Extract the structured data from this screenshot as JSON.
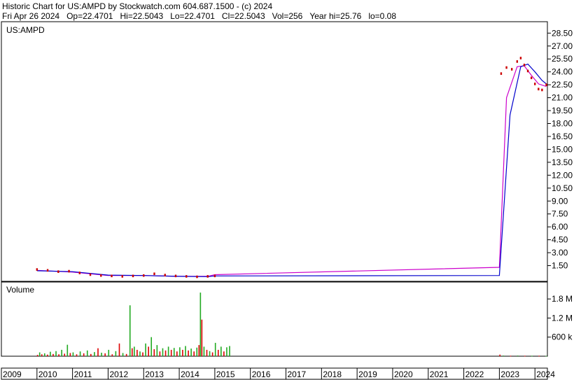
{
  "header": {
    "title": "Historic Chart for US:AMPD by Stockwatch.com 604.687.1500 - (c) 2024",
    "date": "Fri Apr 26 2024",
    "open": "Op=22.4701",
    "high": "Hi=22.5043",
    "low": "Lo=22.4701",
    "close": "Cl=22.5043",
    "volume": "Vol=256",
    "year_high": "Year hi=25.76",
    "year_low": "lo=0.08"
  },
  "colors": {
    "price_dots": "#cc0000",
    "ma_short": "#cc00cc",
    "ma_long": "#0000cc",
    "vol_up": "#22aa22",
    "vol_down": "#dd0000"
  },
  "chart_data": [
    {
      "type": "line",
      "title": "US:AMPD",
      "y_ticks": [
        "28.50",
        "27.00",
        "25.50",
        "24.00",
        "22.50",
        "21.00",
        "19.50",
        "18.00",
        "16.50",
        "15.00",
        "13.50",
        "12.00",
        "10.50",
        "9.00",
        "7.50",
        "6.00",
        "4.50",
        "3.00",
        "1.50"
      ],
      "ylim": [
        0,
        29.5
      ],
      "x_ticks": [
        "2009",
        "2010",
        "2011",
        "2012",
        "2013",
        "2014",
        "2015",
        "2016",
        "2017",
        "2018",
        "2019",
        "2020",
        "2021",
        "2022",
        "2023",
        "2024"
      ],
      "series": [
        {
          "role": "price",
          "x": [
            2010.0,
            2010.3,
            2010.6,
            2010.9,
            2011.2,
            2011.5,
            2011.8,
            2012.1,
            2012.4,
            2012.7,
            2013.0,
            2013.3,
            2013.6,
            2013.9,
            2014.2,
            2014.5,
            2014.8,
            2015.0,
            2023.05,
            2023.2,
            2023.35,
            2023.5,
            2023.6,
            2023.7,
            2023.8,
            2023.9,
            2024.0,
            2024.1,
            2024.2,
            2024.32
          ],
          "y": [
            1.05,
            0.95,
            0.8,
            0.85,
            0.65,
            0.45,
            0.35,
            0.3,
            0.25,
            0.3,
            0.35,
            0.55,
            0.4,
            0.3,
            0.25,
            0.2,
            0.25,
            0.3,
            23.8,
            24.5,
            24.3,
            25.2,
            25.6,
            24.8,
            24.1,
            23.3,
            22.6,
            22.0,
            21.9,
            22.5
          ]
        },
        {
          "role": "ma_short",
          "x": [
            2010.0,
            2011.0,
            2012.0,
            2013.0,
            2014.0,
            2014.8,
            2015.0,
            2023.0,
            2023.2,
            2023.5,
            2023.7,
            2023.9,
            2024.1,
            2024.32
          ],
          "y": [
            0.95,
            0.75,
            0.35,
            0.35,
            0.25,
            0.25,
            0.45,
            1.3,
            21.0,
            24.6,
            24.7,
            23.6,
            22.6,
            22.3
          ]
        },
        {
          "role": "ma_long",
          "x": [
            2010.0,
            2011.0,
            2012.0,
            2013.0,
            2014.0,
            2014.8,
            2015.0,
            2023.0,
            2023.3,
            2023.6,
            2023.8,
            2024.0,
            2024.2,
            2024.32
          ],
          "y": [
            0.9,
            0.8,
            0.4,
            0.35,
            0.25,
            0.22,
            0.3,
            0.35,
            19.0,
            24.6,
            24.9,
            24.0,
            23.0,
            22.6
          ]
        }
      ]
    },
    {
      "type": "bar",
      "title": "Volume",
      "y_ticks": [
        "1.8 M",
        "1.2 M",
        "600 k"
      ],
      "y_tick_values": [
        1800000,
        1200000,
        600000
      ],
      "ylim": [
        0,
        2200000
      ],
      "bars": [
        {
          "x": 2010.0,
          "v": 40000,
          "up": false
        },
        {
          "x": 2010.06,
          "v": 120000,
          "up": true
        },
        {
          "x": 2010.12,
          "v": 60000,
          "up": false
        },
        {
          "x": 2010.2,
          "v": 90000,
          "up": true
        },
        {
          "x": 2010.28,
          "v": 50000,
          "up": false
        },
        {
          "x": 2010.36,
          "v": 140000,
          "up": true
        },
        {
          "x": 2010.44,
          "v": 70000,
          "up": false
        },
        {
          "x": 2010.52,
          "v": 160000,
          "up": true
        },
        {
          "x": 2010.6,
          "v": 60000,
          "up": false
        },
        {
          "x": 2010.68,
          "v": 200000,
          "up": true
        },
        {
          "x": 2010.76,
          "v": 80000,
          "up": false
        },
        {
          "x": 2010.84,
          "v": 360000,
          "up": true
        },
        {
          "x": 2010.92,
          "v": 100000,
          "up": false
        },
        {
          "x": 2011.0,
          "v": 120000,
          "up": true
        },
        {
          "x": 2011.1,
          "v": 60000,
          "up": false
        },
        {
          "x": 2011.2,
          "v": 150000,
          "up": true
        },
        {
          "x": 2011.3,
          "v": 90000,
          "up": false
        },
        {
          "x": 2011.4,
          "v": 180000,
          "up": true
        },
        {
          "x": 2011.5,
          "v": 70000,
          "up": false
        },
        {
          "x": 2011.6,
          "v": 130000,
          "up": true
        },
        {
          "x": 2011.7,
          "v": 250000,
          "up": false
        },
        {
          "x": 2011.8,
          "v": 110000,
          "up": true
        },
        {
          "x": 2011.9,
          "v": 90000,
          "up": false
        },
        {
          "x": 2012.0,
          "v": 200000,
          "up": true
        },
        {
          "x": 2012.1,
          "v": 60000,
          "up": false
        },
        {
          "x": 2012.2,
          "v": 160000,
          "up": true
        },
        {
          "x": 2012.3,
          "v": 400000,
          "up": false
        },
        {
          "x": 2012.4,
          "v": 100000,
          "up": true
        },
        {
          "x": 2012.5,
          "v": 70000,
          "up": false
        },
        {
          "x": 2012.6,
          "v": 1600000,
          "up": true
        },
        {
          "x": 2012.66,
          "v": 250000,
          "up": false
        },
        {
          "x": 2012.72,
          "v": 300000,
          "up": true
        },
        {
          "x": 2012.8,
          "v": 200000,
          "up": false
        },
        {
          "x": 2012.88,
          "v": 150000,
          "up": true
        },
        {
          "x": 2012.96,
          "v": 120000,
          "up": false
        },
        {
          "x": 2013.04,
          "v": 400000,
          "up": true
        },
        {
          "x": 2013.12,
          "v": 300000,
          "up": false
        },
        {
          "x": 2013.2,
          "v": 600000,
          "up": true
        },
        {
          "x": 2013.28,
          "v": 220000,
          "up": false
        },
        {
          "x": 2013.36,
          "v": 350000,
          "up": true
        },
        {
          "x": 2013.44,
          "v": 150000,
          "up": false
        },
        {
          "x": 2013.52,
          "v": 250000,
          "up": true
        },
        {
          "x": 2013.6,
          "v": 180000,
          "up": false
        },
        {
          "x": 2013.68,
          "v": 300000,
          "up": true
        },
        {
          "x": 2013.76,
          "v": 200000,
          "up": false
        },
        {
          "x": 2013.84,
          "v": 260000,
          "up": true
        },
        {
          "x": 2013.92,
          "v": 150000,
          "up": false
        },
        {
          "x": 2014.0,
          "v": 280000,
          "up": true
        },
        {
          "x": 2014.08,
          "v": 200000,
          "up": false
        },
        {
          "x": 2014.16,
          "v": 320000,
          "up": true
        },
        {
          "x": 2014.24,
          "v": 180000,
          "up": false
        },
        {
          "x": 2014.32,
          "v": 240000,
          "up": true
        },
        {
          "x": 2014.4,
          "v": 150000,
          "up": false
        },
        {
          "x": 2014.48,
          "v": 270000,
          "up": true
        },
        {
          "x": 2014.54,
          "v": 350000,
          "up": false
        },
        {
          "x": 2014.58,
          "v": 2000000,
          "up": true
        },
        {
          "x": 2014.62,
          "v": 1150000,
          "up": false
        },
        {
          "x": 2014.68,
          "v": 300000,
          "up": true
        },
        {
          "x": 2014.76,
          "v": 200000,
          "up": false
        },
        {
          "x": 2014.84,
          "v": 160000,
          "up": true
        },
        {
          "x": 2014.92,
          "v": 120000,
          "up": false
        },
        {
          "x": 2015.0,
          "v": 420000,
          "up": true
        },
        {
          "x": 2015.08,
          "v": 200000,
          "up": false
        },
        {
          "x": 2015.16,
          "v": 300000,
          "up": true
        },
        {
          "x": 2015.24,
          "v": 150000,
          "up": false
        },
        {
          "x": 2015.32,
          "v": 280000,
          "up": true
        },
        {
          "x": 2015.4,
          "v": 320000,
          "up": true
        },
        {
          "x": 2023.0,
          "v": 50000,
          "up": false
        },
        {
          "x": 2023.1,
          "v": 20000,
          "up": true
        },
        {
          "x": 2023.3,
          "v": 15000,
          "up": false
        },
        {
          "x": 2023.5,
          "v": 20000,
          "up": true
        },
        {
          "x": 2023.7,
          "v": 15000,
          "up": false
        },
        {
          "x": 2023.9,
          "v": 15000,
          "up": true
        },
        {
          "x": 2024.1,
          "v": 15000,
          "up": false
        },
        {
          "x": 2024.3,
          "v": 10000,
          "up": true
        }
      ]
    }
  ]
}
